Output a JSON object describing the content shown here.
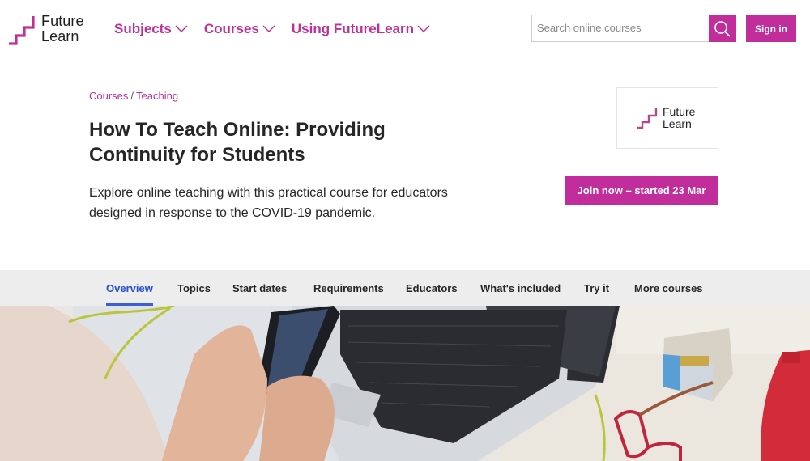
{
  "header": {
    "logo": {
      "line1": "Future",
      "line2": "Learn",
      "icon": "stairs-logo-icon"
    },
    "nav": [
      {
        "label": "Subjects",
        "icon": "chevron-down-icon"
      },
      {
        "label": "Courses",
        "icon": "chevron-down-icon"
      },
      {
        "label": "Using FutureLearn",
        "icon": "chevron-down-icon"
      }
    ],
    "search": {
      "placeholder": "Search online courses",
      "value": "",
      "button_icon": "search-icon"
    },
    "signin_label": "Sign in"
  },
  "course": {
    "breadcrumb": [
      {
        "label": "Courses"
      },
      {
        "label": "Teaching"
      }
    ],
    "breadcrumb_separator": "/",
    "title": "How To Teach Online: Providing Continuity for Students",
    "description": "Explore online teaching with this practical course for educators designed in response to the COVID-19 pandemic.",
    "partner_logo": {
      "line1": "Future",
      "line2": "Learn"
    },
    "join_label": "Join now – started 23 Mar"
  },
  "tabs": [
    {
      "label": "Overview",
      "active": true
    },
    {
      "label": "Topics",
      "active": false
    },
    {
      "label": "Start dates",
      "active": false
    },
    {
      "label": "Requirements",
      "active": false
    },
    {
      "label": "Educators",
      "active": false
    },
    {
      "label": "What's included",
      "active": false
    },
    {
      "label": "Try it",
      "active": false
    },
    {
      "label": "More courses",
      "active": false
    }
  ],
  "hero_image": {
    "description": "Hands holding a smartphone next to a laptop, glasses and paperclip box on a desk"
  },
  "colors": {
    "brand": "#c12d9b",
    "active_tab": "#3d5fd4",
    "tabs_bg": "#ededed",
    "text": "#262626"
  }
}
